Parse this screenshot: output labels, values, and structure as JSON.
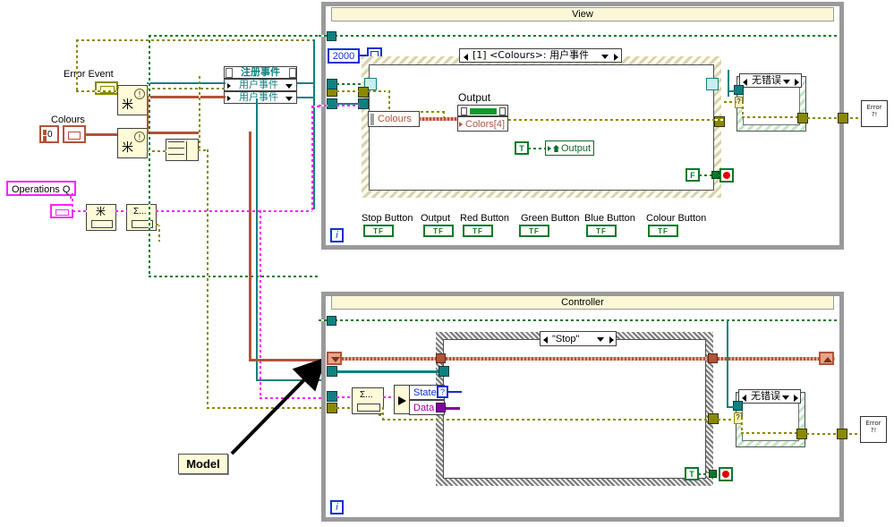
{
  "diagram": {
    "type": "labview-block-diagram",
    "annotation": "Model"
  },
  "left_panel": {
    "error_event_label": "Error Event",
    "colours_label": "Colours",
    "colours_value": "0",
    "operations_queue_label": "Operations Q",
    "register_events": {
      "title": "注册事件",
      "rows": [
        {
          "label": "用户事件"
        },
        {
          "label": "用户事件"
        }
      ]
    },
    "nodes": [
      {
        "name": "create-user-event-1",
        "glyph": "米"
      },
      {
        "name": "create-user-event-2",
        "glyph": "米"
      },
      {
        "name": "bundle-cluster",
        "glyph": "→"
      },
      {
        "name": "obtain-queue",
        "glyph": "米"
      },
      {
        "name": "enqueue-element",
        "glyph": "Σ..."
      }
    ]
  },
  "view_panel": {
    "title": "View",
    "timeout_constant": "2000",
    "event_case_label": "[1] <Colours>: 用户事件",
    "colours_terminal": "Colours",
    "colors_array": "Colors[4]",
    "output_label": "Output",
    "output_prop_node": "Output",
    "true_const": "T",
    "false_const": "F",
    "error_case_label": "无错误",
    "iteration_label": "i",
    "error_handler": "Error\n?!",
    "buttons": [
      {
        "label": "Stop Button",
        "value": "TF"
      },
      {
        "label": "Output",
        "value": "TF"
      },
      {
        "label": "Red Button",
        "value": "TF"
      },
      {
        "label": "Green Button",
        "value": "TF"
      },
      {
        "label": "Blue Button",
        "value": "TF"
      },
      {
        "label": "Colour Button",
        "value": "TF"
      }
    ]
  },
  "controller_panel": {
    "title": "Controller",
    "case_label": "\"Stop\"",
    "state_label": "State",
    "data_label": "Data",
    "dequeue_node": "Σ...",
    "true_const": "T",
    "error_case_label": "无错误",
    "iteration_label": "i",
    "error_handler": "Error\n?!"
  },
  "colors": {
    "error_wire": "#8a8a00",
    "refnum_wire": "#108080",
    "boolean_wire": "#0a7a2a",
    "cluster_wire": "#b0543a",
    "queue_wire": "#ff22ff",
    "numeric_wire": "#1030d0",
    "panel_border": "#9a9a9a",
    "titlebar_bg": "#fbf8d8",
    "node_bg": "#fffbd9"
  }
}
